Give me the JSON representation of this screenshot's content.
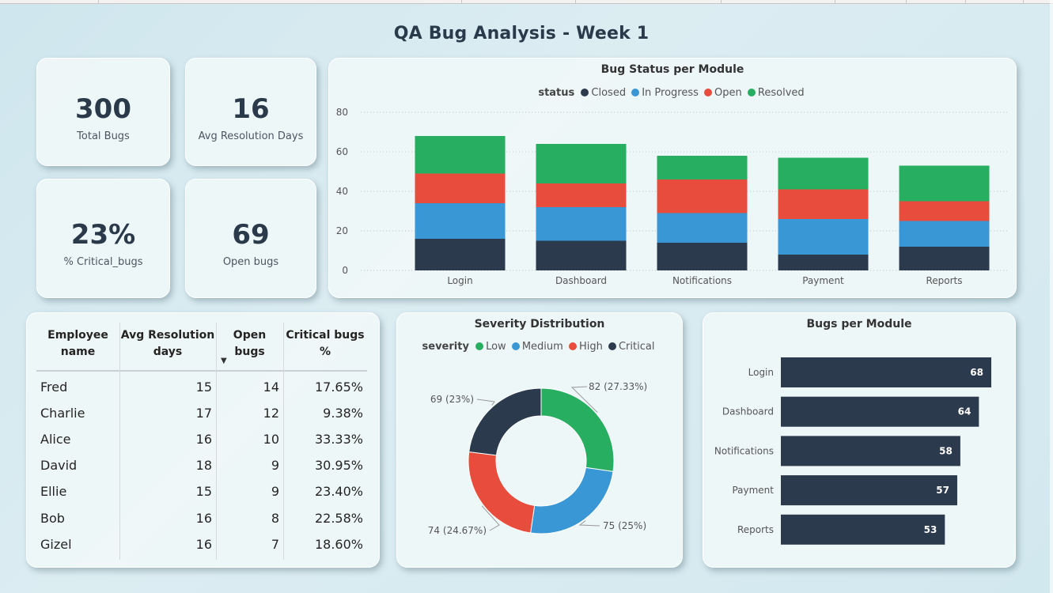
{
  "title": "QA Bug Analysis - Week 1",
  "colors": {
    "closed": "#2c3a4e",
    "in_progress": "#3a97d6",
    "open": "#e74c3c",
    "resolved": "#27ae60",
    "bar": "#2c3a4e"
  },
  "kpis": [
    {
      "value": "300",
      "label": "Total Bugs"
    },
    {
      "value": "16",
      "label": "Avg Resolution Days"
    },
    {
      "value": "23%",
      "label": "% Critical_bugs"
    },
    {
      "value": "69",
      "label": "Open bugs"
    }
  ],
  "status_chart": {
    "title": "Bug Status per Module",
    "legend_title": "status",
    "legend": [
      "Closed",
      "In Progress",
      "Open",
      "Resolved"
    ]
  },
  "severity_chart": {
    "title": "Severity Distribution",
    "legend_title": "severity",
    "legend": [
      "Low",
      "Medium",
      "High",
      "Critical"
    ],
    "labels": [
      "82 (27.33%)",
      "75 (25%)",
      "74 (24.67%)",
      "69 (23%)"
    ]
  },
  "module_chart": {
    "title": "Bugs per Module"
  },
  "table": {
    "headers": {
      "name_line1": "Employee",
      "name_line2": "name",
      "days_line1": "Avg Resolution",
      "days_line2": "days",
      "open_line1": "Open",
      "open_line2": "bugs",
      "crit_line1": "Critical bugs",
      "crit_line2": "%"
    },
    "rows": [
      {
        "name": "Fred",
        "days": "15",
        "open": "14",
        "crit": "17.65%"
      },
      {
        "name": "Charlie",
        "days": "17",
        "open": "12",
        "crit": "9.38%"
      },
      {
        "name": "Alice",
        "days": "16",
        "open": "10",
        "crit": "33.33%"
      },
      {
        "name": "David",
        "days": "18",
        "open": "9",
        "crit": "30.95%"
      },
      {
        "name": "Ellie",
        "days": "15",
        "open": "9",
        "crit": "23.40%"
      },
      {
        "name": "Bob",
        "days": "16",
        "open": "8",
        "crit": "22.58%"
      },
      {
        "name": "Gizel",
        "days": "16",
        "open": "7",
        "crit": "18.60%"
      }
    ]
  },
  "chart_data": [
    {
      "type": "bar",
      "stacked": true,
      "title": "Bug Status per Module",
      "categories": [
        "Login",
        "Dashboard",
        "Notifications",
        "Payment",
        "Reports"
      ],
      "series": [
        {
          "name": "Closed",
          "values": [
            16,
            15,
            14,
            8,
            12
          ]
        },
        {
          "name": "In Progress",
          "values": [
            18,
            17,
            15,
            18,
            13
          ]
        },
        {
          "name": "Open",
          "values": [
            15,
            12,
            17,
            15,
            10
          ]
        },
        {
          "name": "Resolved",
          "values": [
            19,
            20,
            12,
            16,
            18
          ]
        }
      ],
      "ylim": [
        0,
        80
      ],
      "yticks": [
        0,
        20,
        40,
        60,
        80
      ],
      "legend_title": "status",
      "legend_position": "top-center",
      "grid": true
    },
    {
      "type": "pie",
      "donut": true,
      "title": "Severity Distribution",
      "categories": [
        "Low",
        "Medium",
        "High",
        "Critical"
      ],
      "values": [
        82,
        75,
        74,
        69
      ],
      "labels": [
        "82 (27.33%)",
        "75 (25%)",
        "74 (24.67%)",
        "69 (23%)"
      ],
      "legend_title": "severity",
      "legend_position": "top-center"
    },
    {
      "type": "bar",
      "orientation": "horizontal",
      "title": "Bugs per Module",
      "categories": [
        "Login",
        "Dashboard",
        "Notifications",
        "Payment",
        "Reports"
      ],
      "values": [
        68,
        64,
        58,
        57,
        53
      ],
      "data_labels": true
    }
  ]
}
